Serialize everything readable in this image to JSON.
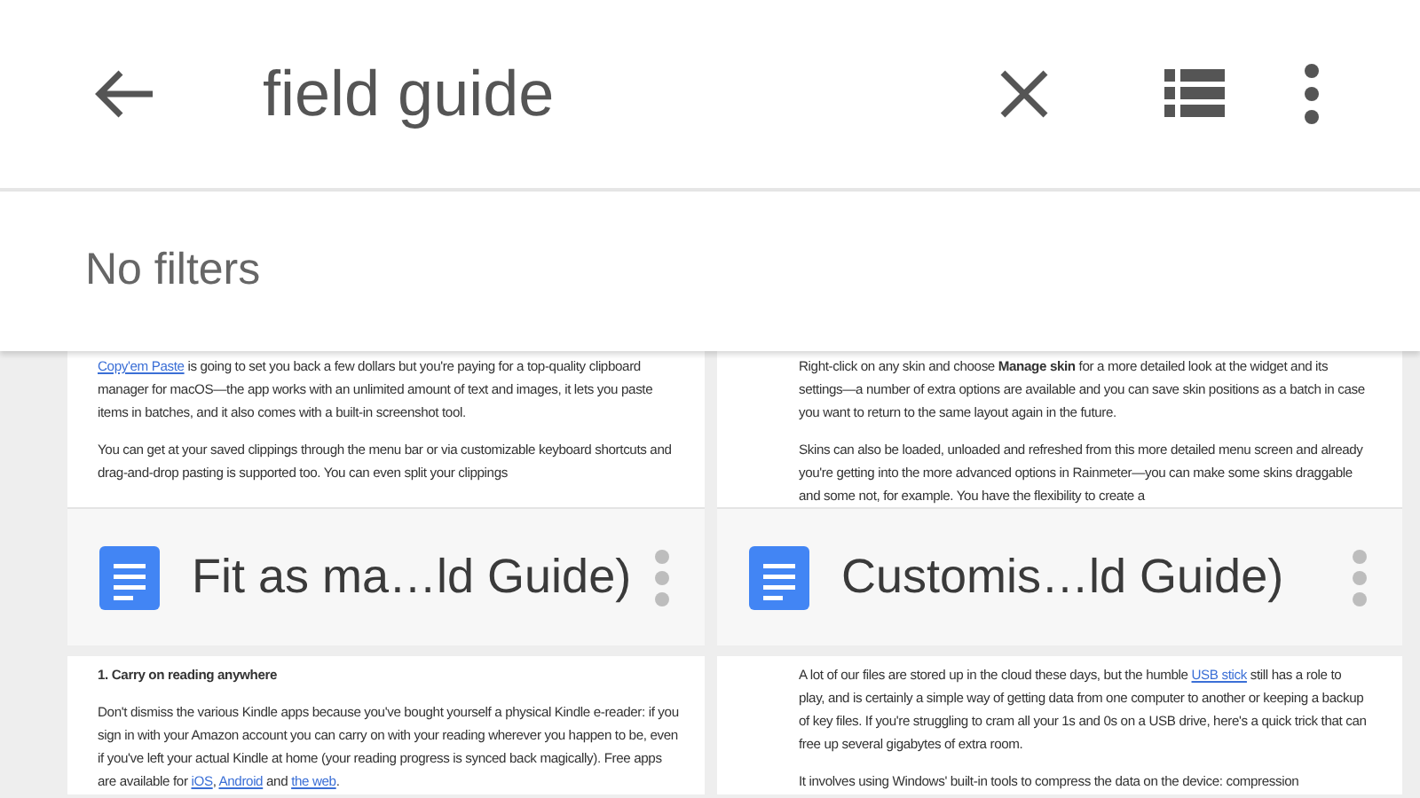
{
  "search": {
    "value": "field guide"
  },
  "filter_bar": {
    "label": "No filters"
  },
  "documents": [
    {
      "title": "Fit as ma…ld Guide)",
      "preview": [
        [
          {
            "kind": "link",
            "text": "Copy'em Paste"
          },
          {
            "kind": "text",
            "text": " is going to set you back a few dollars but you're paying for a top-quality clipboard manager for macOS—the app works with an unlimited amount of text and images, it lets you paste items in batches, and it also comes with a built-in screenshot tool."
          }
        ],
        [
          {
            "kind": "text",
            "text": "You can get at your saved clippings through the menu bar or via customizable keyboard shortcuts and drag-and-drop pasting is supported too. You can even split your clippings"
          }
        ]
      ]
    },
    {
      "title": "Customis…ld Guide)",
      "preview": [
        [
          {
            "kind": "text",
            "text": "Right-click on any skin and choose "
          },
          {
            "kind": "bold",
            "text": "Manage skin"
          },
          {
            "kind": "text",
            "text": " for a more detailed look at the widget and its settings—a number of extra options are available and you can save skin positions as a batch in case you want to return to the same layout again in the future."
          }
        ],
        [
          {
            "kind": "text",
            "text": "Skins can also be loaded, unloaded and refreshed from this more detailed menu screen and already you're getting into the more advanced options in Rainmeter—you can make some skins draggable and some not, for example. You have the flexibility to create a"
          }
        ]
      ]
    },
    {
      "preview": [
        [
          {
            "kind": "bold",
            "text": "1. Carry on reading anywhere"
          }
        ],
        [
          {
            "kind": "text",
            "text": "Don't dismiss the various Kindle apps because you've bought yourself a physical Kindle e-reader: if you sign in with your Amazon account you can carry on with your reading wherever you happen to be, even if you've left your actual Kindle at home (your reading progress is synced back magically). Free apps are available for "
          },
          {
            "kind": "link",
            "text": "iOS"
          },
          {
            "kind": "text",
            "text": ", "
          },
          {
            "kind": "link",
            "text": "Android"
          },
          {
            "kind": "text",
            "text": " and "
          },
          {
            "kind": "link",
            "text": "the web"
          },
          {
            "kind": "text",
            "text": "."
          }
        ]
      ]
    },
    {
      "preview": [
        [
          {
            "kind": "text",
            "text": "A lot of our files are stored up in the cloud these days, but the humble "
          },
          {
            "kind": "link",
            "text": "USB stick"
          },
          {
            "kind": "text",
            "text": " still has a role to play, and is certainly a simple way of getting data from one computer to another or keeping a backup of key files. If you're struggling to cram all your 1s and 0s on a USB drive, here's a quick trick that can free up several gigabytes of extra room."
          }
        ],
        [
          {
            "kind": "text",
            "text": "It involves using Windows' built-in tools to compress the data on the device: compression"
          }
        ]
      ]
    }
  ]
}
